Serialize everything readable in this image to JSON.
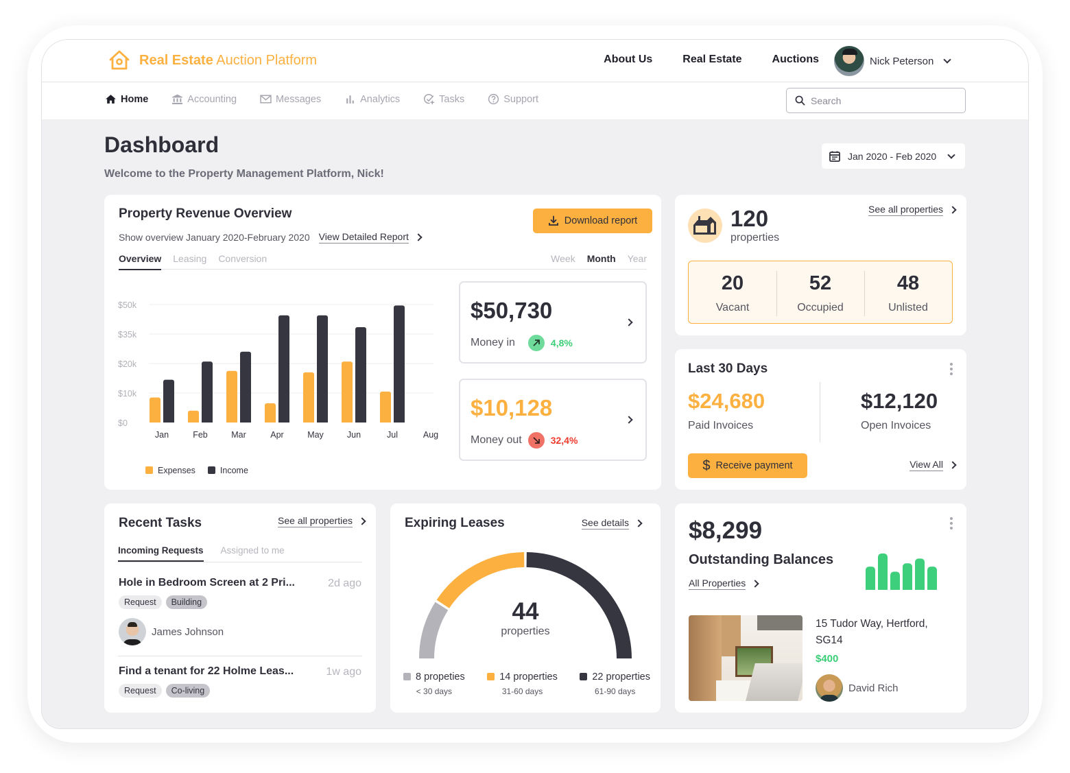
{
  "app": {
    "brand_bold": "Real Estate",
    "brand_light": "Auction Platform",
    "top_links": [
      "About Us",
      "Real Estate",
      "Auctions"
    ],
    "user_name": "Nick Peterson"
  },
  "nav": {
    "items": [
      {
        "label": "Home",
        "icon": "home-icon",
        "active": true
      },
      {
        "label": "Accounting",
        "icon": "bank-icon",
        "active": false
      },
      {
        "label": "Messages",
        "icon": "mail-icon",
        "active": false
      },
      {
        "label": "Analytics",
        "icon": "bar-chart-icon",
        "active": false
      },
      {
        "label": "Tasks",
        "icon": "task-check-icon",
        "active": false
      },
      {
        "label": "Support",
        "icon": "help-circle-icon",
        "active": false
      }
    ],
    "search_placeholder": "Search"
  },
  "header": {
    "title": "Dashboard",
    "welcome": "Welcome to the Property Management Platform, Nick!",
    "date_range": "Jan 2020 - Feb 2020"
  },
  "revenue": {
    "title": "Property Revenue Overview",
    "subtitle": "Show overview January 2020-February 2020",
    "detail_link": "View Detailed Report",
    "download_label": "Download report",
    "tabs": [
      "Overview",
      "Leasing",
      "Conversion"
    ],
    "active_tab": "Overview",
    "periods": [
      "Week",
      "Month",
      "Year"
    ],
    "active_period": "Month",
    "money_in": {
      "amount": "$50,730",
      "label": "Money in",
      "change": "4,8%"
    },
    "money_out": {
      "amount": "$10,128",
      "label": "Money out",
      "change": "32,4%"
    }
  },
  "chart_data": {
    "type": "bar",
    "title": "",
    "xlabel": "",
    "ylabel": "",
    "categories": [
      "Jan",
      "Feb",
      "Mar",
      "Apr",
      "May",
      "Jun",
      "Jul",
      "Aug"
    ],
    "y_ticks": [
      "$0",
      "$10k",
      "$20k",
      "$35k",
      "$50k"
    ],
    "y_tick_values": [
      0,
      10000,
      20000,
      35000,
      50000
    ],
    "ylim": [
      0,
      50000
    ],
    "grid": true,
    "legend_position": "bottom-left",
    "series": [
      {
        "name": "Expenses",
        "color": "#fbb040",
        "values": [
          8500,
          4000,
          17500,
          6500,
          17000,
          21000,
          10500,
          null
        ]
      },
      {
        "name": "Income",
        "color": "#363641",
        "values": [
          14500,
          21000,
          26000,
          44500,
          44500,
          38500,
          49500,
          null
        ]
      }
    ]
  },
  "properties": {
    "count": "120",
    "count_label": "properties",
    "see_all": "See all properties",
    "stats": [
      {
        "value": "20",
        "label": "Vacant"
      },
      {
        "value": "52",
        "label": "Occupied"
      },
      {
        "value": "48",
        "label": "Unlisted"
      }
    ]
  },
  "last30": {
    "title": "Last 30 Days",
    "paid_amount": "$24,680",
    "paid_label": "Paid Invoices",
    "open_amount": "$12,120",
    "open_label": "Open Invoices",
    "receive_label": "Receive payment",
    "view_all": "View All"
  },
  "tasks": {
    "title": "Recent Tasks",
    "see_all": "See all properties",
    "tabs": [
      "Incoming Requests",
      "Assigned to me"
    ],
    "active_tab": "Incoming Requests",
    "items": [
      {
        "title": "Hole in Bedroom Screen at 2 Pri...",
        "ago": "2d ago",
        "tags": [
          "Request",
          "Building"
        ],
        "assignee": "James Johnson"
      },
      {
        "title": "Find a tenant for 22 Holme Leas...",
        "ago": "1w ago",
        "tags": [
          "Request",
          "Co-living"
        ]
      }
    ]
  },
  "leases": {
    "title": "Expiring Leases",
    "see_details": "See details",
    "total": "44",
    "total_label": "properties",
    "segments": [
      {
        "count_label": "8 propeties",
        "range": "< 30 days",
        "value": 8,
        "color": "#b3b3b9"
      },
      {
        "count_label": "14 properties",
        "range": "31-60 days",
        "value": 14,
        "color": "#fbb040"
      },
      {
        "count_label": "22 properties",
        "range": "61-90 days",
        "value": 22,
        "color": "#363641"
      }
    ]
  },
  "outstanding": {
    "amount": "$8,299",
    "title": "Outstanding Balances",
    "link": "All Properties",
    "mini_bars": [
      0.64,
      1.0,
      0.5,
      0.73,
      0.86,
      0.64
    ],
    "mini_bar_color": "#3dcf7b",
    "property": {
      "address": "15 Tudor Way, Hertford, SG14",
      "price": "$400",
      "owner": "David Rich"
    }
  }
}
